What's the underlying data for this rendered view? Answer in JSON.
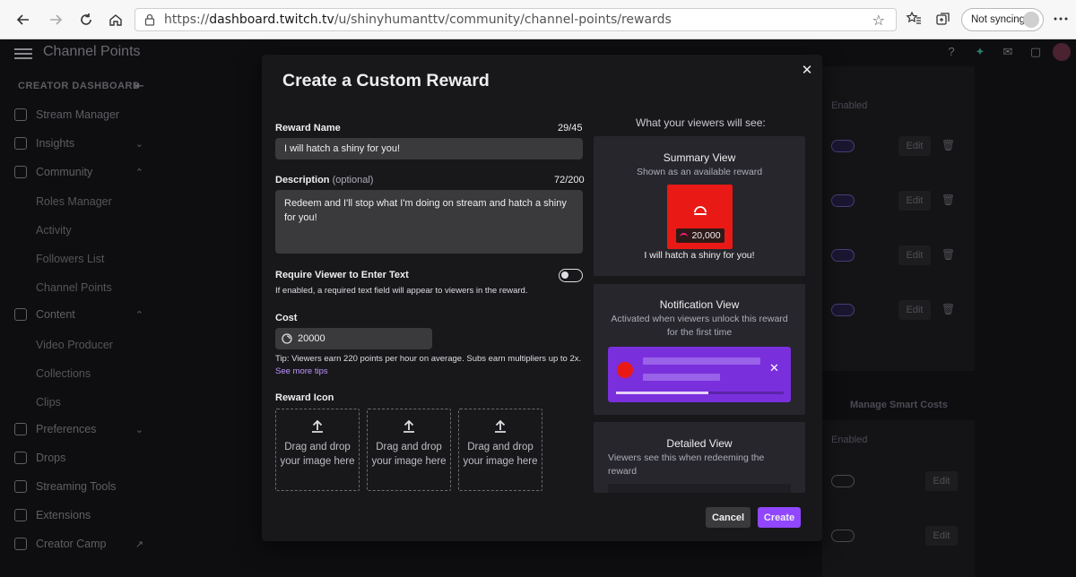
{
  "browser": {
    "url_prefix": "https://",
    "url_host": "dashboard.twitch.tv",
    "url_path": "/u/shinyhumanttv/community/channel-points/rewards",
    "sync_label": "Not syncing"
  },
  "app": {
    "title": "Channel Points",
    "sidebar_heading": "CREATOR DASHBOARD",
    "sidebar": [
      {
        "label": "Stream Manager"
      },
      {
        "label": "Insights"
      },
      {
        "label": "Community"
      },
      {
        "label": "Roles Manager"
      },
      {
        "label": "Activity"
      },
      {
        "label": "Followers List"
      },
      {
        "label": "Channel Points"
      },
      {
        "label": "Content"
      },
      {
        "label": "Video Producer"
      },
      {
        "label": "Collections"
      },
      {
        "label": "Clips"
      },
      {
        "label": "Preferences"
      },
      {
        "label": "Drops"
      },
      {
        "label": "Streaming Tools"
      },
      {
        "label": "Extensions"
      },
      {
        "label": "Creator Camp"
      }
    ],
    "bg_enabled_label": "Enabled",
    "bg_edit_label": "Edit",
    "bg_manage_label": "Manage Smart Costs"
  },
  "modal": {
    "title": "Create a Custom Reward",
    "reward_name_label": "Reward Name",
    "reward_name_count": "29/45",
    "reward_name_value": "I will hatch a shiny for you!",
    "description_label": "Description",
    "description_optional": "(optional)",
    "description_count": "72/200",
    "description_value": "Redeem and I'll stop what I'm doing on stream and hatch a shiny for you!",
    "require_text_label": "Require Viewer to Enter Text",
    "require_text_help": "If enabled, a required text field will appear to viewers in the reward.",
    "require_text_enabled": false,
    "cost_label": "Cost",
    "cost_value": "20000",
    "tip_text": "Tip: Viewers earn 220 points per hour on average. Subs earn multipliers up to 2x.",
    "tip_link": "See more tips",
    "icon_label": "Reward Icon",
    "drop_zones": [
      "Drag and drop your image here",
      "Drag and drop your image here",
      "Drag and drop your image here"
    ],
    "cancel_label": "Cancel",
    "create_label": "Create"
  },
  "preview": {
    "heading": "What your viewers will see:",
    "summary_title": "Summary View",
    "summary_sub": "Shown as an available reward",
    "summary_cost": "20,000",
    "summary_name": "I will hatch a shiny for you!",
    "notification_title": "Notification View",
    "notification_sub": "Activated when viewers unlock this reward for the first time",
    "notification_progress": 0.55,
    "detailed_title": "Detailed View",
    "detailed_sub": "Viewers see this when redeeming the reward"
  },
  "colors": {
    "accent": "#9147ff",
    "reward_red": "#e91916",
    "link": "#bf94ff"
  }
}
